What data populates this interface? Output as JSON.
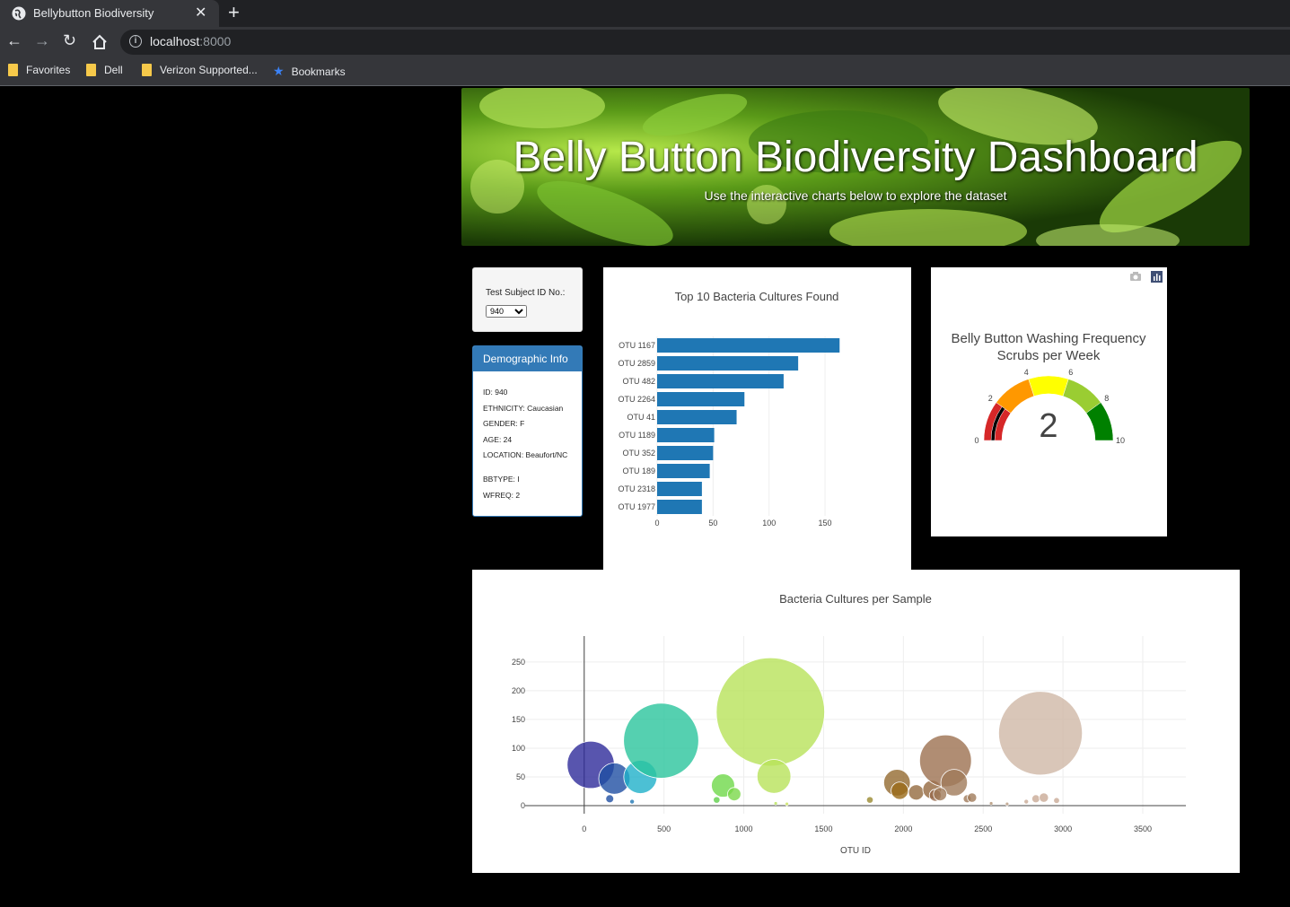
{
  "browser": {
    "tab_title": "Bellybutton Biodiversity",
    "url_host": "localhost",
    "url_port": ":8000",
    "bookmarks": [
      "Favorites",
      "Dell",
      "Verizon Supported...",
      "Bookmarks"
    ]
  },
  "hero": {
    "title": "Belly Button Biodiversity Dashboard",
    "subtitle": "Use the interactive charts below to explore the dataset"
  },
  "selector": {
    "label": "Test Subject ID No.:",
    "selected": "940"
  },
  "demographic": {
    "heading": "Demographic Info",
    "rows": [
      "ID: 940",
      "ETHNICITY: Caucasian",
      "GENDER: F",
      "AGE: 24",
      "LOCATION: Beaufort/NC",
      "BBTYPE: I",
      "WFREQ: 2"
    ]
  },
  "chart_data": [
    {
      "type": "bar",
      "orientation": "horizontal",
      "title": "Top 10 Bacteria Cultures Found",
      "categories": [
        "OTU 1167",
        "OTU 2859",
        "OTU 482",
        "OTU 2264",
        "OTU 41",
        "OTU 1189",
        "OTU 352",
        "OTU 189",
        "OTU 2318",
        "OTU 1977"
      ],
      "values": [
        163,
        126,
        113,
        78,
        71,
        51,
        50,
        47,
        40,
        40
      ],
      "xticks": [
        0,
        50,
        100,
        150
      ],
      "xlim": [
        0,
        170
      ],
      "color": "#1f77b4"
    },
    {
      "type": "gauge",
      "title": "Belly Button Washing Frequency",
      "subtitle": "Scrubs per Week",
      "value": 2,
      "range": [
        0,
        10
      ],
      "ticks": [
        0,
        2,
        4,
        6,
        8,
        10
      ],
      "steps": [
        {
          "range": [
            0,
            2
          ],
          "color": "#d62728"
        },
        {
          "range": [
            2,
            4
          ],
          "color": "#ff9800"
        },
        {
          "range": [
            4,
            6
          ],
          "color": "#ffff00"
        },
        {
          "range": [
            6,
            8
          ],
          "color": "#9acd32"
        },
        {
          "range": [
            8,
            10
          ],
          "color": "#008000"
        }
      ],
      "bar_color": "#000000"
    },
    {
      "type": "scatter",
      "mode": "bubble",
      "title": "Bacteria Cultures per Sample",
      "xlabel": "OTU ID",
      "xlim": [
        -370,
        3770
      ],
      "ylim": [
        -14,
        295
      ],
      "xticks": [
        0,
        500,
        1000,
        1500,
        2000,
        2500,
        3000,
        3500
      ],
      "yticks": [
        0,
        50,
        100,
        150,
        200,
        250
      ],
      "grid": true,
      "points": [
        {
          "x": 41,
          "y": 71,
          "c": "#2e2a9a"
        },
        {
          "x": 189,
          "y": 47,
          "c": "#1f4fa3"
        },
        {
          "x": 352,
          "y": 50,
          "c": "#1fb0c9"
        },
        {
          "x": 482,
          "y": 113,
          "c": "#2bc49c"
        },
        {
          "x": 870,
          "y": 35,
          "c": "#6fd84a"
        },
        {
          "x": 940,
          "y": 20,
          "c": "#7bd84a"
        },
        {
          "x": 1167,
          "y": 163,
          "c": "#b8e25a"
        },
        {
          "x": 1189,
          "y": 51,
          "c": "#b8e25a"
        },
        {
          "x": 1960,
          "y": 40,
          "c": "#946a2f"
        },
        {
          "x": 1977,
          "y": 26,
          "c": "#9a6a18"
        },
        {
          "x": 2080,
          "y": 23,
          "c": "#946a3f"
        },
        {
          "x": 2180,
          "y": 28,
          "c": "#94683f"
        },
        {
          "x": 2200,
          "y": 18,
          "c": "#96684a"
        },
        {
          "x": 2264,
          "y": 78,
          "c": "#9c7050"
        },
        {
          "x": 2318,
          "y": 40,
          "c": "#a07a5a"
        },
        {
          "x": 2230,
          "y": 20,
          "c": "#a07a5a"
        },
        {
          "x": 2859,
          "y": 126,
          "c": "#cfb8a6"
        },
        {
          "x": 160,
          "y": 12,
          "c": "#1f4fa3"
        },
        {
          "x": 300,
          "y": 7,
          "c": "#1f77b4"
        },
        {
          "x": 830,
          "y": 10,
          "c": "#5fcf4a"
        },
        {
          "x": 1790,
          "y": 10,
          "c": "#9a8a2f"
        },
        {
          "x": 2400,
          "y": 12,
          "c": "#a07a5a"
        },
        {
          "x": 2430,
          "y": 14,
          "c": "#a07a5a"
        },
        {
          "x": 2830,
          "y": 12,
          "c": "#c9aa96"
        },
        {
          "x": 2880,
          "y": 14,
          "c": "#c9aa96"
        },
        {
          "x": 2960,
          "y": 9,
          "c": "#c9aa96"
        },
        {
          "x": 2770,
          "y": 7,
          "c": "#c9aa96"
        },
        {
          "x": 1200,
          "y": 4,
          "c": "#b8e25a"
        },
        {
          "x": 1270,
          "y": 3,
          "c": "#c8e25a"
        },
        {
          "x": 2550,
          "y": 4,
          "c": "#b09070"
        },
        {
          "x": 2650,
          "y": 3,
          "c": "#b89a80"
        }
      ]
    }
  ]
}
